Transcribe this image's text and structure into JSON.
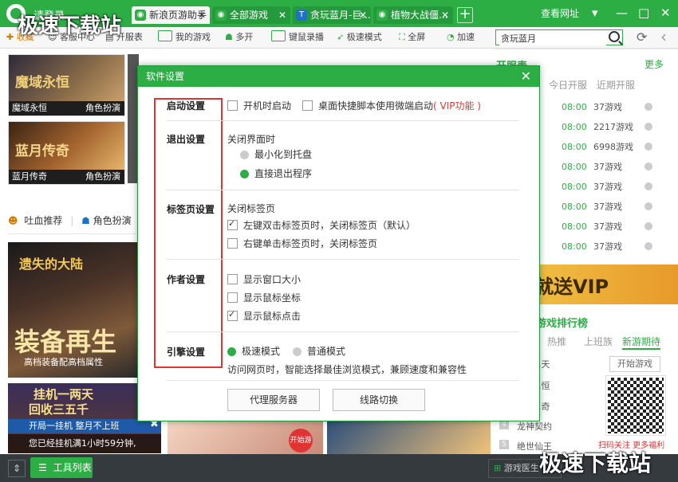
{
  "titlebar": {
    "login_label": "请登录",
    "tabs": [
      {
        "label": "新浪页游助手",
        "icon": "game-controller-icon",
        "active": true
      },
      {
        "label": "全部游戏",
        "icon": "game-controller-icon",
        "active": false
      },
      {
        "label": "贪玩蓝月-巨...",
        "icon": "t-logo-icon",
        "active": false
      },
      {
        "label": "植物大战僵...",
        "icon": "game-controller-icon",
        "active": false
      }
    ],
    "new_tab": "+",
    "web_url_button": "查看网址",
    "controls": [
      "▾",
      "—",
      "□",
      "✕"
    ]
  },
  "toolbar": {
    "items": [
      "我的游戏",
      "多开",
      "键鼠录播",
      "极速模式",
      "全屏",
      "加速"
    ],
    "partial_items": [
      "收藏",
      "客服中心",
      "开服表"
    ],
    "search_value": "贪玩蓝月",
    "refresh": "⟳",
    "back": "‹"
  },
  "main": {
    "cards": [
      {
        "caption": "魔域永恒",
        "tag": "角色扮演"
      },
      {
        "caption": "蓝月传奇",
        "tag": "角色扮演"
      }
    ],
    "tabs": [
      "吐血推荐",
      "角色扮演"
    ],
    "banner_text": "装备再生",
    "banner_subtext": "高档装备配高档属性",
    "banner_top_text": "遗失的大陆",
    "promo_lines": [
      "挂机一两天",
      "回收三五千"
    ],
    "notice_title": "开局一挂机 整月不上班",
    "notice_text": "您已经挂机满1小时59分钟,",
    "start_badge": "开始游戏"
  },
  "right_panel": {
    "header": "开服表",
    "more": "更多",
    "columns": [
      "今日开服",
      "近期开服"
    ],
    "rows": [
      {
        "time": "08:00",
        "company": "37游戏"
      },
      {
        "time": "08:00",
        "company": "2217游戏"
      },
      {
        "time": "08:00",
        "company": "6998游戏"
      },
      {
        "time": "08:00",
        "company": "37游戏"
      },
      {
        "time": "08:00",
        "company": "37游戏"
      },
      {
        "time": "08:00",
        "company": "37游戏"
      },
      {
        "time": "08:00",
        "company": "37游戏"
      },
      {
        "time": "08:00",
        "company": "37游戏"
      }
    ],
    "vip_banner": "就送VIP",
    "ranking_title": "游戏排行榜",
    "ranking_tabs": [
      "热推",
      "上班族",
      "新游期待"
    ],
    "start_game": "开始游戏",
    "ranking_items": [
      "...天",
      "...恒",
      "...奇",
      "龙神契约",
      "绝世仙王"
    ],
    "qr_caption": "扫码关注 更多福利"
  },
  "bottombar": {
    "tool_list": "工具列表",
    "assistant": "游戏医生"
  },
  "watermark": {
    "top": "极速下载站",
    "bottom": "极速下载站"
  },
  "dialog": {
    "title": "软件设置",
    "sections": {
      "startup": {
        "label": "启动设置",
        "options": [
          {
            "label": "开机时启动",
            "checked": false
          },
          {
            "label": "桌面快捷脚本使用微端启动",
            "checked": false,
            "note": "( VIP功能 )"
          }
        ]
      },
      "exit": {
        "label": "退出设置",
        "sublabel": "关闭界面时",
        "options": [
          {
            "label": "最小化到托盘",
            "selected": false
          },
          {
            "label": "直接退出程序",
            "selected": true
          }
        ]
      },
      "tab": {
        "label": "标签页设置",
        "sublabel": "关闭标签页",
        "options": [
          {
            "label": "左键双击标签页时，关闭标签页（默认）",
            "checked": true
          },
          {
            "label": "右键单击标签页时，关闭标签页",
            "checked": false
          }
        ]
      },
      "author": {
        "label": "作者设置",
        "options": [
          {
            "label": "显示窗口大小",
            "checked": false
          },
          {
            "label": "显示鼠标坐标",
            "checked": false
          },
          {
            "label": "显示鼠标点击",
            "checked": true
          }
        ]
      },
      "engine": {
        "label": "引擎设置",
        "options": [
          {
            "label": "极速模式",
            "selected": true
          },
          {
            "label": "普通模式",
            "selected": false
          }
        ],
        "description": "访问网页时，智能选择最佳浏览模式，兼顾速度和兼容性"
      }
    },
    "buttons": {
      "proxy": "代理服务器",
      "route": "线路切换"
    },
    "close": "✕"
  },
  "colors": {
    "brand_green": "#2cae45",
    "highlight_red": "#e03434"
  }
}
